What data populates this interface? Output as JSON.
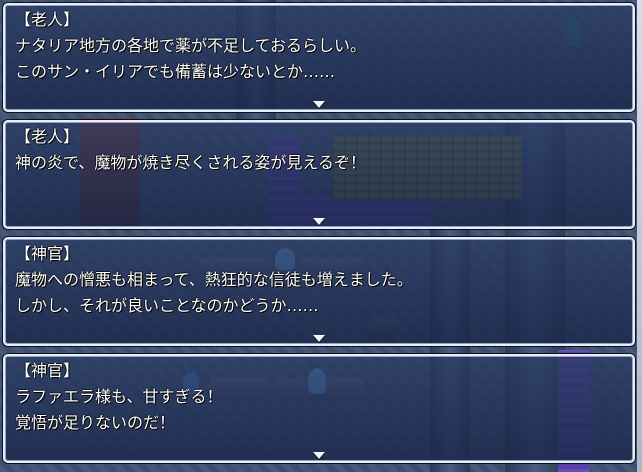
{
  "windows": [
    {
      "speaker": "【老人】",
      "lines": [
        "ナタリア地方の各地で薬が不足しておるらしい。",
        "このサン・イリアでも備蓄は少ないとか……"
      ]
    },
    {
      "speaker": "【老人】",
      "lines": [
        "神の炎で、魔物が焼き尽くされる姿が見えるぞ！",
        ""
      ]
    },
    {
      "speaker": "【神官】",
      "lines": [
        "魔物への憎悪も相まって、熱狂的な信徒も増えました。",
        "しかし、それが良いことなのかどうか……"
      ]
    },
    {
      "speaker": "【神官】",
      "lines": [
        "ラファエラ様も、甘すぎる！",
        "覚悟が足りないのだ！"
      ]
    }
  ],
  "colors": {
    "window_border": "#e8eef8",
    "window_fill": "#28406a",
    "text": "#ffffff"
  },
  "icons": {
    "continue_indicator": "pause-arrow-icon"
  }
}
